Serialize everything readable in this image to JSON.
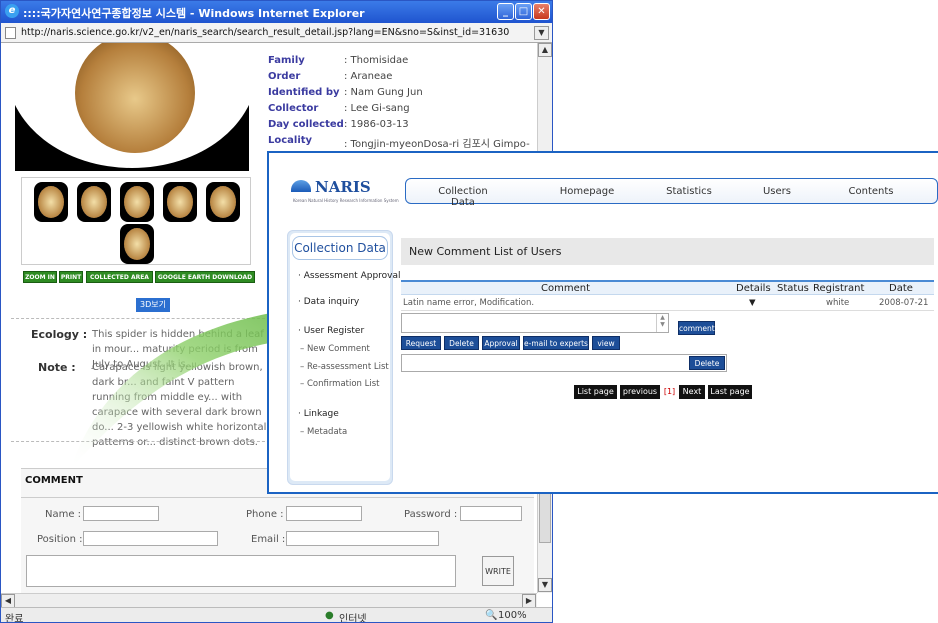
{
  "window": {
    "title": "::::국가자연사연구종합정보 시스템 - Windows Internet Explorer",
    "url": "http://naris.science.go.kr/v2_en/naris_search/search_result_detail.jsp?lang=EN&sno=S&inst_id=31630"
  },
  "specimen": [
    {
      "label": "Family",
      "value": ": Thomisidae"
    },
    {
      "label": "Order",
      "value": ": Araneae"
    },
    {
      "label": "Identified by",
      "value": ": Nam Gung Jun"
    },
    {
      "label": "Collector",
      "value": ": Lee Gi-sang"
    },
    {
      "label": "Day collected",
      "value": ": 1986-03-13"
    },
    {
      "label": "Locality",
      "value": ": Tongjin-myeonDosa-ri 김포시 Gimpo-"
    }
  ],
  "media_buttons": {
    "zoom": "ZOOM IN",
    "print": "PRINT",
    "area": "COLLECTED AREA",
    "earth": "GOOGLE EARTH DOWNLOAD",
    "view3d": "3D보기"
  },
  "ecology": {
    "label": "Ecology :",
    "text": "This spider is hidden behind a leaf in mour... maturity period is from July to August. It is...",
    "note_label": "Note :",
    "note_text": "Carapace is light yellowish brown, dark br... and faint V pattern running from middle ey... with carapace with several dark brown do... 2-3 yellowish white horizontal patterns or... distinct brown dots."
  },
  "comment_form": {
    "title": "COMMENT",
    "name": "Name :",
    "phone": "Phone :",
    "password": "Password :",
    "position": "Position :",
    "email": "Email :",
    "write": "WRITE"
  },
  "statusbar": {
    "left": "완료",
    "zone": "인터넷",
    "zoom": "100%"
  },
  "naris": {
    "logo": "NARIS",
    "logo_sub": "Korean Natural History Research Information System",
    "nav": [
      "Collection Data",
      "Homepage",
      "Statistics",
      "Users",
      "Contents"
    ],
    "sidebar_title": "Collection Data",
    "sidebar": {
      "assessment": "· Assessment Approval",
      "data_inquiry": "· Data inquiry",
      "user_register": "· User Register",
      "new_comment": "– New Comment",
      "reassessment": "– Re-assessment List",
      "confirmation": "– Confirmation List",
      "linkage": "· Linkage",
      "metadata": "– Metadata"
    },
    "page_title": "New Comment List  of Users",
    "columns": [
      "Comment",
      "Details",
      "Status",
      "Registrant",
      "Date"
    ],
    "row": {
      "comment": "Latin name error, Modification.",
      "details": "▼",
      "status": "",
      "registrant": "white",
      "date": "2008-07-21"
    },
    "comment_btn": "comment",
    "actions": [
      "Request",
      "Delete",
      "Approval",
      "e-mail to experts",
      "view"
    ],
    "delete_btn": "Delete",
    "pager": {
      "list": "List page",
      "prev": "previous",
      "current": "[1]",
      "next": "Next",
      "last": "Last page"
    }
  }
}
